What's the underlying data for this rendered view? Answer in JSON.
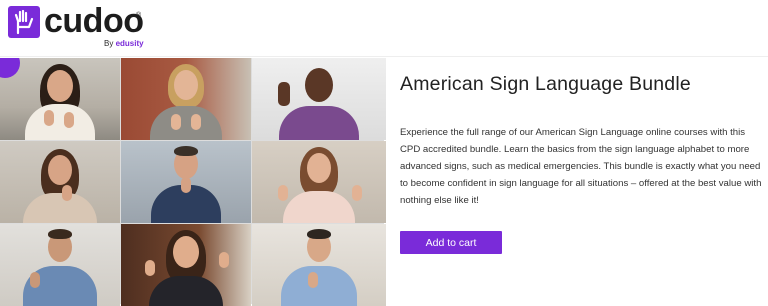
{
  "brand": {
    "name": "cudoo",
    "registered": "®",
    "by_prefix": "By",
    "by_name": "edusity",
    "accent": "#7a2bd9"
  },
  "product": {
    "title": "American Sign Language Bundle",
    "description": "Experience the full range of our American Sign Language online courses with this CPD accredited bundle. Learn the basics from the sign language alphabet to more advanced signs, such as medical emergencies. This bundle is exactly what you need to become confident in sign language for all situations – offered at the best value with nothing else like it!",
    "add_to_cart_label": "Add to cart"
  },
  "image": {
    "subject": "video-call grid of nine people using sign language",
    "tiles": 9
  }
}
